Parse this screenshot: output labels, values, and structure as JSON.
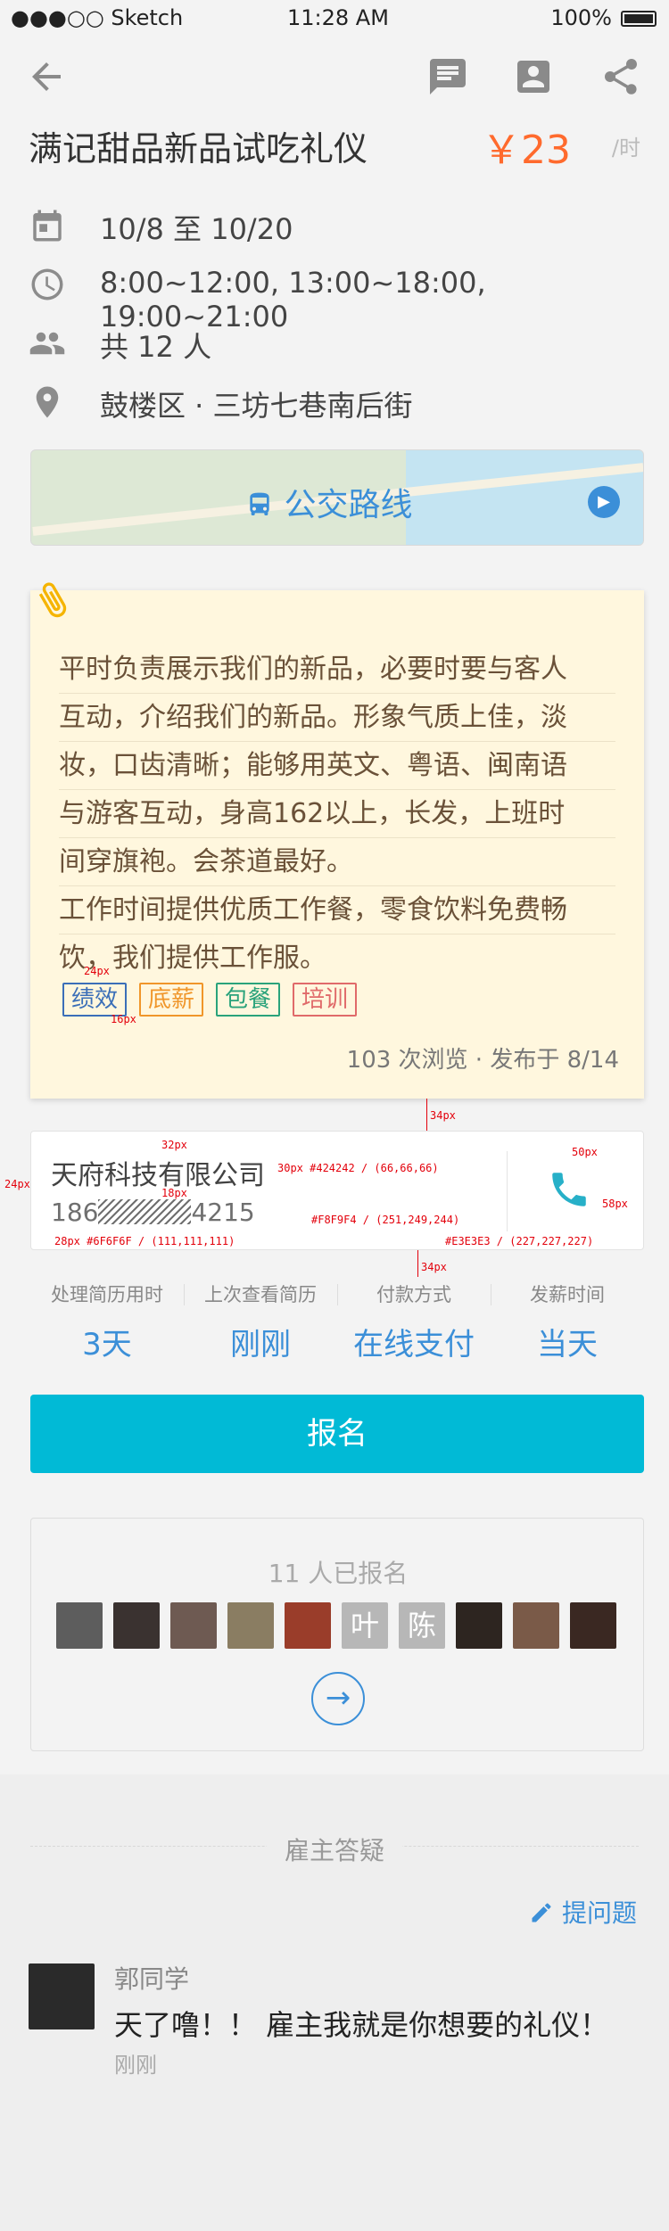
{
  "statusbar": {
    "carrier": "●●●○○ Sketch",
    "time": "11:28 AM",
    "battery": "100%"
  },
  "job": {
    "title": "满记甜品新品试吃礼仪",
    "price": "￥23",
    "price_unit": "/时"
  },
  "info": {
    "date": "10/8 至 10/20",
    "hours": "8:00~12:00, 13:00~18:00, 19:00~21:00",
    "headcount": "共 12 人",
    "location": "鼓楼区 · 三坊七巷南后街"
  },
  "map": {
    "label": "公交路线"
  },
  "note": {
    "lines": [
      "平时负责展示我们的新品，必要时要与客人",
      "互动，介绍我们的新品。形象气质上佳，淡",
      "妆，口齿清晰；能够用英文、粤语、闽南语",
      "与游客互动，身高162以上，长发，上班时",
      "间穿旗袍。会茶道最好。",
      "工作时间提供优质工作餐，零食饮料免费畅",
      "饮，我们提供工作服。"
    ],
    "tags": [
      {
        "label": "绩效",
        "color": "#3b6fb8"
      },
      {
        "label": "底薪",
        "color": "#f0962a"
      },
      {
        "label": "包餐",
        "color": "#2aa37b"
      },
      {
        "label": "培训",
        "color": "#e06a6a"
      }
    ],
    "footer": "103 次浏览 · 发布于 8/14"
  },
  "company": {
    "name": "天府科技有限公司",
    "phone_prefix": "186",
    "phone_suffix": "4215"
  },
  "annotations": {
    "a1": "24px",
    "a2": "16px",
    "a3": "34px",
    "a4": "32px",
    "a5": "24px",
    "a6": "30px #424242 / (66,66,66)",
    "a7": "50px",
    "a8": "18px",
    "a9": "#F8F9F4 / (251,249,244)",
    "a10": "58px",
    "a11": "28px #6F6F6F / (111,111,111)",
    "a12": "#E3E3E3 / (227,227,227)",
    "a13": "34px"
  },
  "stats": [
    {
      "key": "处理简历用时",
      "value": "3天"
    },
    {
      "key": "上次查看简历",
      "value": "刚刚"
    },
    {
      "key": "付款方式",
      "value": "在线支付"
    },
    {
      "key": "发薪时间",
      "value": "当天"
    }
  ],
  "cta": {
    "label": "报名"
  },
  "applicants": {
    "title": "11 人已报名",
    "avatars": [
      "",
      "",
      "",
      "",
      "",
      "叶",
      "陈",
      "",
      "",
      ""
    ]
  },
  "qa": {
    "section": "雇主答疑",
    "ask": "提问题",
    "user": {
      "name": "郭同学",
      "message": "天了噜！！ 雇主我就是你想要的礼仪！",
      "time": "刚刚"
    }
  }
}
